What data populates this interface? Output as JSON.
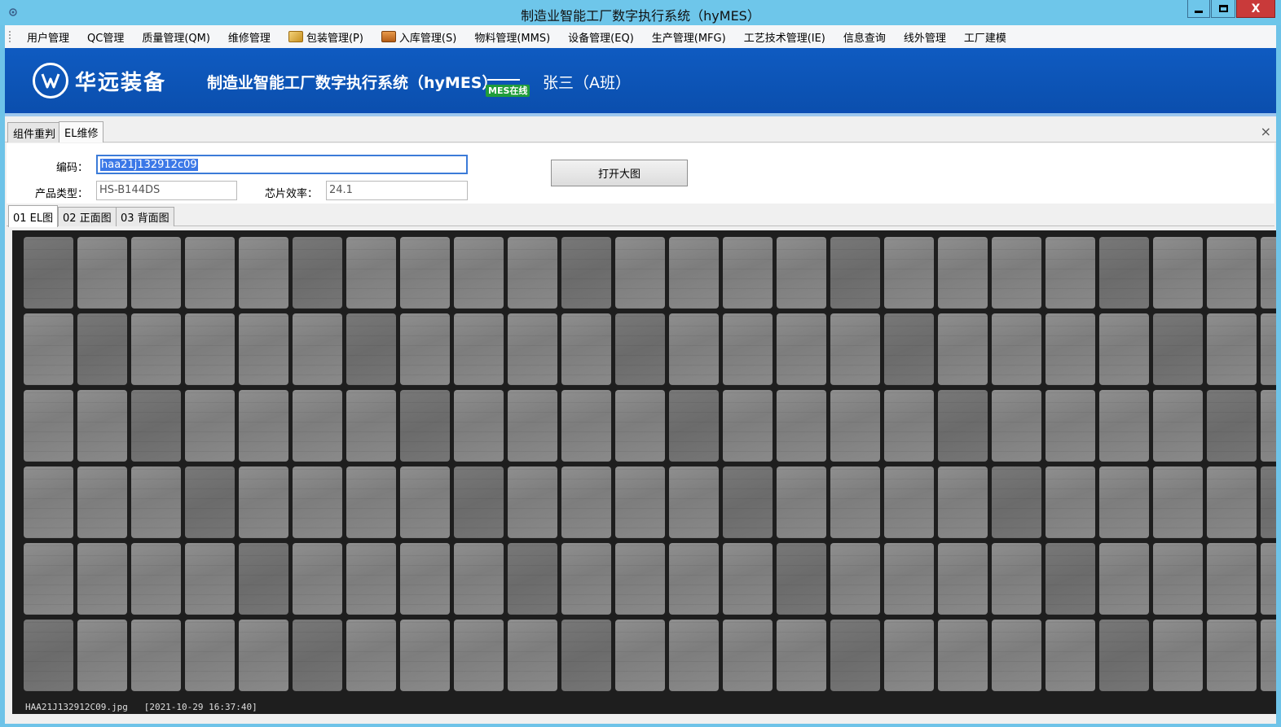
{
  "window": {
    "title": "制造业智能工厂数字执行系统（hyMES）",
    "close_glyph": "X"
  },
  "menu": {
    "items": [
      {
        "label": "用户管理"
      },
      {
        "label": "QC管理"
      },
      {
        "label": "质量管理(QM)"
      },
      {
        "label": "维修管理"
      },
      {
        "label": "包装管理(P)",
        "icon": "package-icon"
      },
      {
        "label": "入库管理(S)",
        "icon": "warehouse-icon"
      },
      {
        "label": "物料管理(MMS)"
      },
      {
        "label": "设备管理(EQ)"
      },
      {
        "label": "生产管理(MFG)"
      },
      {
        "label": "工艺技术管理(IE)"
      },
      {
        "label": "信息查询"
      },
      {
        "label": "线外管理"
      },
      {
        "label": "工厂建模"
      }
    ]
  },
  "banner": {
    "logo_text": "华远装备",
    "system_title": "制造业智能工厂数字执行系统（hyMES）",
    "status_badge": "MES在线",
    "user": "张三（A班）",
    "colors": {
      "banner": "#0b4fae",
      "status": "#1f9c3a"
    }
  },
  "doc_tabs": {
    "items": [
      {
        "label": "组件重判"
      },
      {
        "label": "EL维修"
      }
    ],
    "active": "EL维修",
    "close_glyph": "×"
  },
  "form": {
    "code_label": "编码：",
    "code_value": "haa21j132912c09",
    "product_type_label": "产品类型：",
    "product_type_value": "HS-B144DS",
    "efficiency_label": "芯片效率：",
    "efficiency_value": "24.1",
    "open_button": "打开大图"
  },
  "image_tabs": {
    "items": [
      {
        "label": "01 EL图"
      },
      {
        "label": "02 正面图"
      },
      {
        "label": "03 背面图"
      }
    ],
    "active": "01 EL图"
  },
  "el_image": {
    "caption": "HAA21J132912C09.jpg   [2021-10-29 16:37:40]"
  }
}
